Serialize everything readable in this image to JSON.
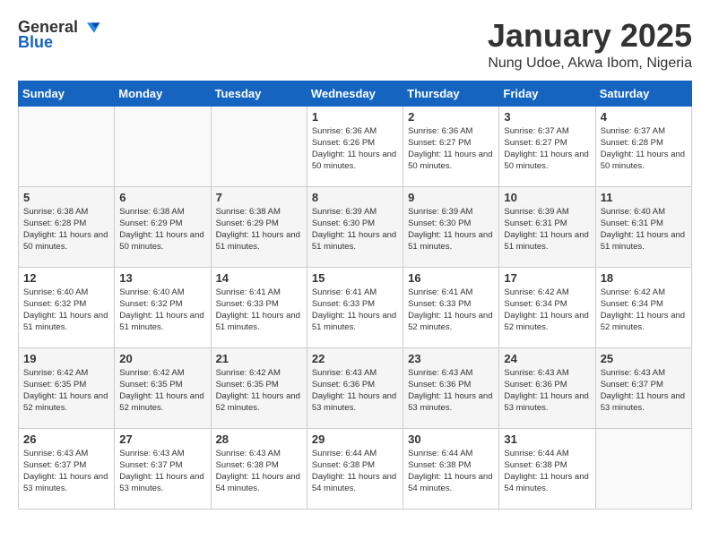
{
  "logo": {
    "general": "General",
    "blue": "Blue"
  },
  "title": {
    "month_year": "January 2025",
    "location": "Nung Udoe, Akwa Ibom, Nigeria"
  },
  "headers": [
    "Sunday",
    "Monday",
    "Tuesday",
    "Wednesday",
    "Thursday",
    "Friday",
    "Saturday"
  ],
  "weeks": [
    [
      {
        "num": "",
        "sunrise": "",
        "sunset": "",
        "daylight": ""
      },
      {
        "num": "",
        "sunrise": "",
        "sunset": "",
        "daylight": ""
      },
      {
        "num": "",
        "sunrise": "",
        "sunset": "",
        "daylight": ""
      },
      {
        "num": "1",
        "sunrise": "Sunrise: 6:36 AM",
        "sunset": "Sunset: 6:26 PM",
        "daylight": "Daylight: 11 hours and 50 minutes."
      },
      {
        "num": "2",
        "sunrise": "Sunrise: 6:36 AM",
        "sunset": "Sunset: 6:27 PM",
        "daylight": "Daylight: 11 hours and 50 minutes."
      },
      {
        "num": "3",
        "sunrise": "Sunrise: 6:37 AM",
        "sunset": "Sunset: 6:27 PM",
        "daylight": "Daylight: 11 hours and 50 minutes."
      },
      {
        "num": "4",
        "sunrise": "Sunrise: 6:37 AM",
        "sunset": "Sunset: 6:28 PM",
        "daylight": "Daylight: 11 hours and 50 minutes."
      }
    ],
    [
      {
        "num": "5",
        "sunrise": "Sunrise: 6:38 AM",
        "sunset": "Sunset: 6:28 PM",
        "daylight": "Daylight: 11 hours and 50 minutes."
      },
      {
        "num": "6",
        "sunrise": "Sunrise: 6:38 AM",
        "sunset": "Sunset: 6:29 PM",
        "daylight": "Daylight: 11 hours and 50 minutes."
      },
      {
        "num": "7",
        "sunrise": "Sunrise: 6:38 AM",
        "sunset": "Sunset: 6:29 PM",
        "daylight": "Daylight: 11 hours and 51 minutes."
      },
      {
        "num": "8",
        "sunrise": "Sunrise: 6:39 AM",
        "sunset": "Sunset: 6:30 PM",
        "daylight": "Daylight: 11 hours and 51 minutes."
      },
      {
        "num": "9",
        "sunrise": "Sunrise: 6:39 AM",
        "sunset": "Sunset: 6:30 PM",
        "daylight": "Daylight: 11 hours and 51 minutes."
      },
      {
        "num": "10",
        "sunrise": "Sunrise: 6:39 AM",
        "sunset": "Sunset: 6:31 PM",
        "daylight": "Daylight: 11 hours and 51 minutes."
      },
      {
        "num": "11",
        "sunrise": "Sunrise: 6:40 AM",
        "sunset": "Sunset: 6:31 PM",
        "daylight": "Daylight: 11 hours and 51 minutes."
      }
    ],
    [
      {
        "num": "12",
        "sunrise": "Sunrise: 6:40 AM",
        "sunset": "Sunset: 6:32 PM",
        "daylight": "Daylight: 11 hours and 51 minutes."
      },
      {
        "num": "13",
        "sunrise": "Sunrise: 6:40 AM",
        "sunset": "Sunset: 6:32 PM",
        "daylight": "Daylight: 11 hours and 51 minutes."
      },
      {
        "num": "14",
        "sunrise": "Sunrise: 6:41 AM",
        "sunset": "Sunset: 6:33 PM",
        "daylight": "Daylight: 11 hours and 51 minutes."
      },
      {
        "num": "15",
        "sunrise": "Sunrise: 6:41 AM",
        "sunset": "Sunset: 6:33 PM",
        "daylight": "Daylight: 11 hours and 51 minutes."
      },
      {
        "num": "16",
        "sunrise": "Sunrise: 6:41 AM",
        "sunset": "Sunset: 6:33 PM",
        "daylight": "Daylight: 11 hours and 52 minutes."
      },
      {
        "num": "17",
        "sunrise": "Sunrise: 6:42 AM",
        "sunset": "Sunset: 6:34 PM",
        "daylight": "Daylight: 11 hours and 52 minutes."
      },
      {
        "num": "18",
        "sunrise": "Sunrise: 6:42 AM",
        "sunset": "Sunset: 6:34 PM",
        "daylight": "Daylight: 11 hours and 52 minutes."
      }
    ],
    [
      {
        "num": "19",
        "sunrise": "Sunrise: 6:42 AM",
        "sunset": "Sunset: 6:35 PM",
        "daylight": "Daylight: 11 hours and 52 minutes."
      },
      {
        "num": "20",
        "sunrise": "Sunrise: 6:42 AM",
        "sunset": "Sunset: 6:35 PM",
        "daylight": "Daylight: 11 hours and 52 minutes."
      },
      {
        "num": "21",
        "sunrise": "Sunrise: 6:42 AM",
        "sunset": "Sunset: 6:35 PM",
        "daylight": "Daylight: 11 hours and 52 minutes."
      },
      {
        "num": "22",
        "sunrise": "Sunrise: 6:43 AM",
        "sunset": "Sunset: 6:36 PM",
        "daylight": "Daylight: 11 hours and 53 minutes."
      },
      {
        "num": "23",
        "sunrise": "Sunrise: 6:43 AM",
        "sunset": "Sunset: 6:36 PM",
        "daylight": "Daylight: 11 hours and 53 minutes."
      },
      {
        "num": "24",
        "sunrise": "Sunrise: 6:43 AM",
        "sunset": "Sunset: 6:36 PM",
        "daylight": "Daylight: 11 hours and 53 minutes."
      },
      {
        "num": "25",
        "sunrise": "Sunrise: 6:43 AM",
        "sunset": "Sunset: 6:37 PM",
        "daylight": "Daylight: 11 hours and 53 minutes."
      }
    ],
    [
      {
        "num": "26",
        "sunrise": "Sunrise: 6:43 AM",
        "sunset": "Sunset: 6:37 PM",
        "daylight": "Daylight: 11 hours and 53 minutes."
      },
      {
        "num": "27",
        "sunrise": "Sunrise: 6:43 AM",
        "sunset": "Sunset: 6:37 PM",
        "daylight": "Daylight: 11 hours and 53 minutes."
      },
      {
        "num": "28",
        "sunrise": "Sunrise: 6:43 AM",
        "sunset": "Sunset: 6:38 PM",
        "daylight": "Daylight: 11 hours and 54 minutes."
      },
      {
        "num": "29",
        "sunrise": "Sunrise: 6:44 AM",
        "sunset": "Sunset: 6:38 PM",
        "daylight": "Daylight: 11 hours and 54 minutes."
      },
      {
        "num": "30",
        "sunrise": "Sunrise: 6:44 AM",
        "sunset": "Sunset: 6:38 PM",
        "daylight": "Daylight: 11 hours and 54 minutes."
      },
      {
        "num": "31",
        "sunrise": "Sunrise: 6:44 AM",
        "sunset": "Sunset: 6:38 PM",
        "daylight": "Daylight: 11 hours and 54 minutes."
      },
      {
        "num": "",
        "sunrise": "",
        "sunset": "",
        "daylight": ""
      }
    ]
  ]
}
